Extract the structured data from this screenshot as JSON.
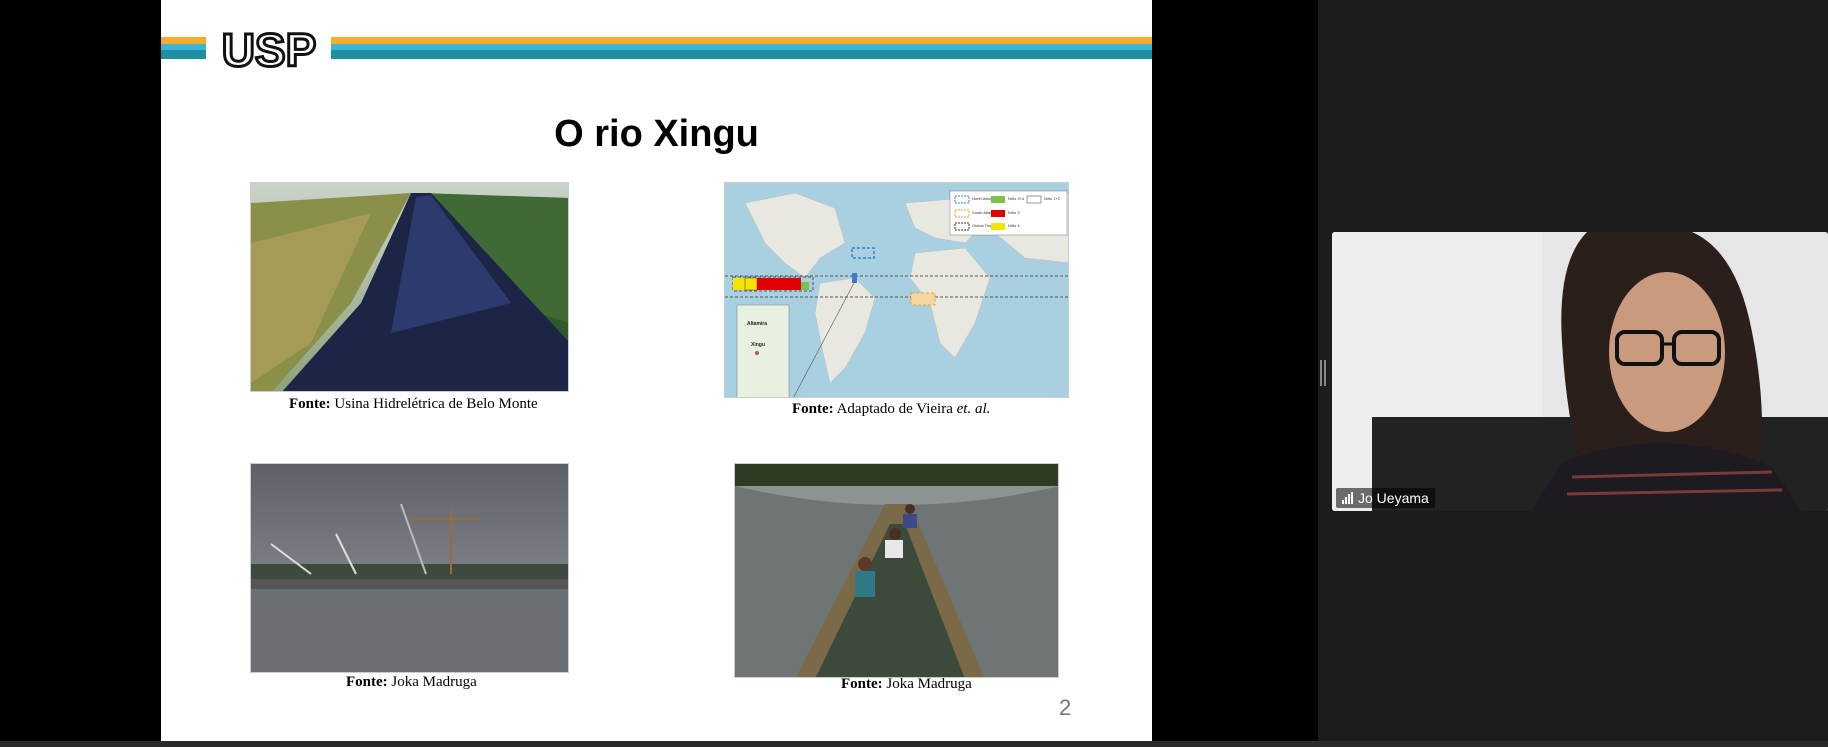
{
  "slide": {
    "title": "O rio Xingu",
    "page_number": "2",
    "logo_text": "USP",
    "captions": [
      {
        "source_label": "Fonte:",
        "text": "Usina Hidrelétrica de Belo Monte"
      },
      {
        "source_label": "Fonte:",
        "text": "Adaptado de Vieira ",
        "italic": "et. al."
      },
      {
        "source_label": "Fonte:",
        "text": "Joka Madruga"
      },
      {
        "source_label": "Fonte:",
        "text": "Joka Madruga"
      }
    ],
    "map": {
      "legend": [
        {
          "label": "North Atlantic",
          "color": "#3a7bd5"
        },
        {
          "label": "South Atlantic",
          "color": "#e8a13a"
        },
        {
          "label": "Global Tropics",
          "color": "#333333"
        },
        {
          "label": "Niño 3+4",
          "color": "#7dc24a"
        },
        {
          "label": "Niño 1+2",
          "color": "#ffffff"
        },
        {
          "label": "Niño 3",
          "color": "#e00000"
        },
        {
          "label": "Niño 4",
          "color": "#f5e300"
        }
      ],
      "inset_labels": [
        "Altamira",
        "Xingu"
      ]
    }
  },
  "video": {
    "participant_name": "Jo Ueyama"
  },
  "colors": {
    "stripe_orange": "#f7ad2c",
    "stripe_cyan": "#3eb5d6",
    "stripe_teal": "#1c8fa2"
  }
}
